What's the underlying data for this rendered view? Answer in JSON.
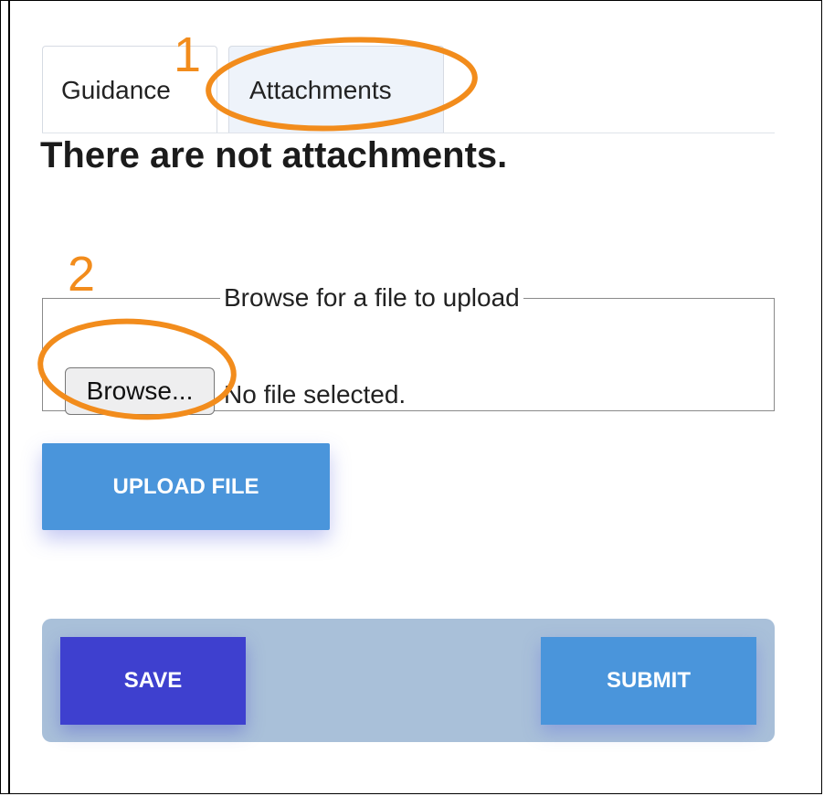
{
  "tabs": [
    {
      "label": "Guidance"
    },
    {
      "label": "Attachments"
    }
  ],
  "heading": "There are not attachments.",
  "upload": {
    "legend": "Browse for a file to upload",
    "browse_label": "Browse...",
    "file_status": "No file selected.",
    "upload_label": "UPLOAD FILE"
  },
  "actions": {
    "save_label": "SAVE",
    "submit_label": "SUBMIT"
  },
  "annotations": {
    "marker_1": "1",
    "marker_2": "2",
    "color": "#f28c1c"
  },
  "colors": {
    "primary_blue": "#4a95db",
    "save_indigo": "#3e40cf",
    "action_bar": "#a9c0d9",
    "active_tab": "#eef3fa"
  }
}
